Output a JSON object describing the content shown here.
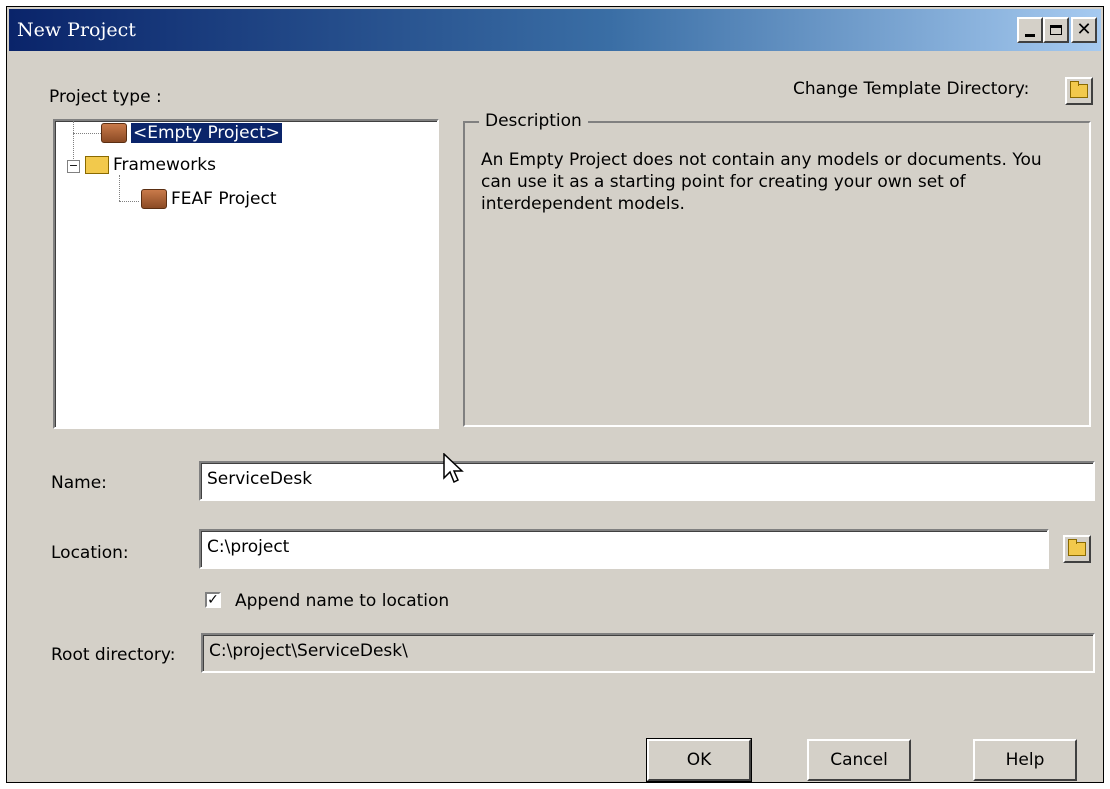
{
  "window": {
    "title": "New Project"
  },
  "project_type": {
    "label": "Project type :",
    "tree": [
      {
        "label": "<Empty Project>",
        "icon": "briefcase-icon",
        "selected": true
      },
      {
        "label": "Frameworks",
        "icon": "folder-icon",
        "expanded": true
      },
      {
        "label": "FEAF Project",
        "icon": "briefcase-icon"
      }
    ]
  },
  "template": {
    "label": "Change Template Directory:"
  },
  "description": {
    "title": "Description",
    "text": "An Empty Project does not contain any models or documents. You can use it as a starting point for creating your own set of interdependent models."
  },
  "form": {
    "name_label": "Name:",
    "name_value": "ServiceDesk",
    "location_label": "Location:",
    "location_value": "C:\\project",
    "append_label": "Append name to location",
    "append_checked": true,
    "root_label": "Root directory:",
    "root_value": "C:\\project\\ServiceDesk\\"
  },
  "buttons": {
    "ok": "OK",
    "cancel": "Cancel",
    "help": "Help"
  }
}
